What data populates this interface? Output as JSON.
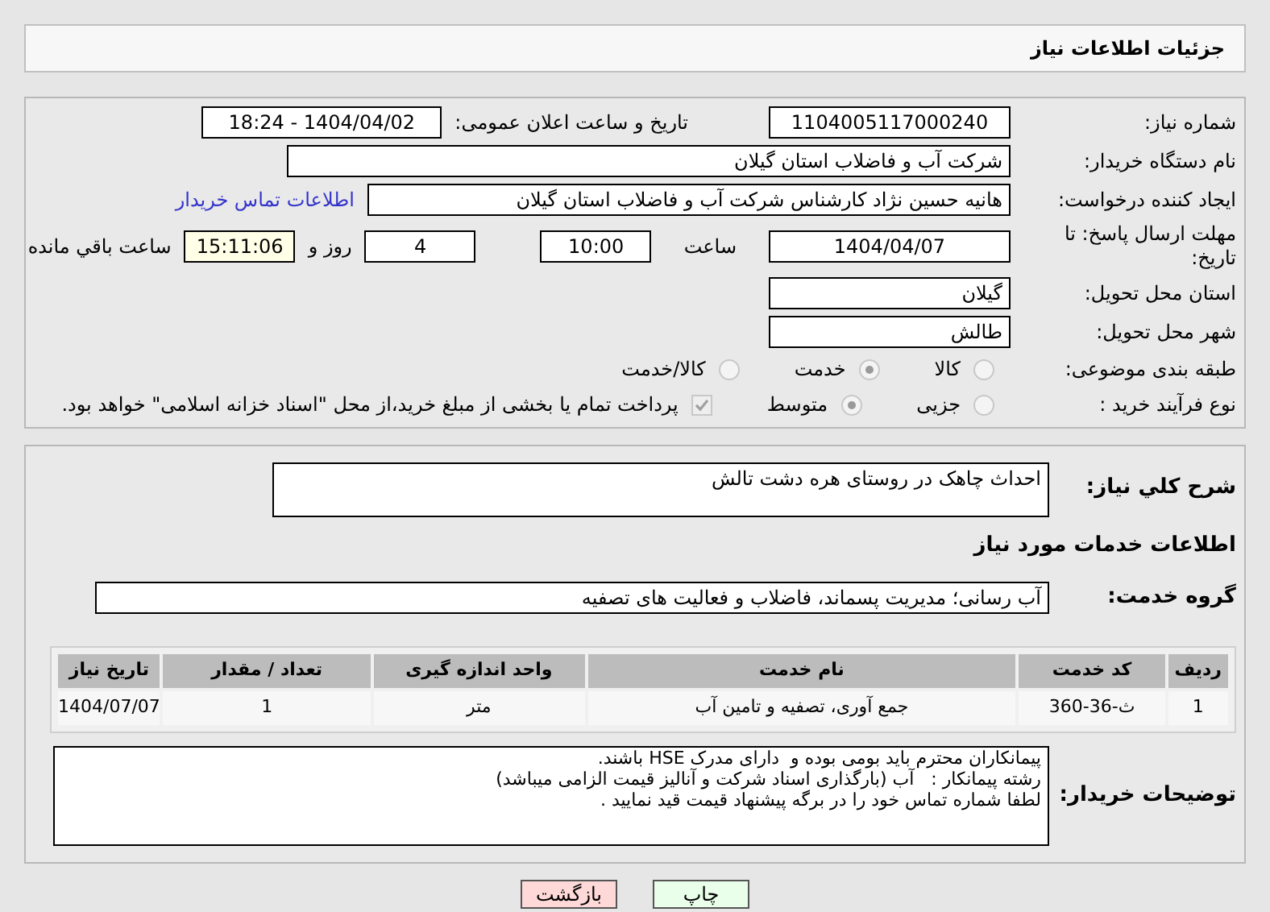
{
  "header": {
    "title": "جزئیات اطلاعات نیاز"
  },
  "need_number": {
    "label": "شماره نیاز:",
    "value": "1104005117000240"
  },
  "announce": {
    "label": "تاریخ و ساعت اعلان عمومی:",
    "value": "1404/04/02 - 18:24"
  },
  "buyer": {
    "label": "نام دستگاه خریدار:",
    "value": "شرکت آب و فاضلاب استان گیلان"
  },
  "creator": {
    "label": "ایجاد کننده درخواست:",
    "value": "هانیه حسین نژاد کارشناس شرکت آب و فاضلاب استان گیلان",
    "link": "اطلاعات تماس خریدار"
  },
  "deadline": {
    "label": "مهلت ارسال پاسخ: تا تاریخ:",
    "date": "1404/04/07",
    "time_label": "ساعت",
    "time": "10:00",
    "days": "4",
    "days_label": "روز و",
    "remaining": "15:11:06",
    "remaining_label": "ساعت باقي مانده"
  },
  "province": {
    "label": "استان محل تحویل:",
    "value": "گیلان"
  },
  "city": {
    "label": "شهر محل تحویل:",
    "value": "طالش"
  },
  "category": {
    "label": "طبقه بندی موضوعی:",
    "options": [
      {
        "label": "کالا",
        "selected": false
      },
      {
        "label": "خدمت",
        "selected": true
      },
      {
        "label": "کالا/خدمت",
        "selected": false
      }
    ]
  },
  "process": {
    "label": "نوع فرآیند خرید :",
    "options": [
      {
        "label": "جزیی",
        "selected": false
      },
      {
        "label": "متوسط",
        "selected": true
      }
    ],
    "payment": {
      "label": "پرداخت تمام یا بخشی از مبلغ خرید،از محل \"اسناد خزانه اسلامی\" خواهد بود.",
      "checked": true
    }
  },
  "summary": {
    "label": "شرح کلي نياز:",
    "value": "احداث چاهک در روستای هره دشت تالش"
  },
  "services_title": "اطلاعات خدمات مورد نیاز",
  "service_group": {
    "label": "گروه خدمت:",
    "value": "آب رسانی؛ مدیریت پسماند، فاضلاب و فعالیت های تصفیه"
  },
  "table": {
    "columns": [
      "ردیف",
      "کد خدمت",
      "نام خدمت",
      "واحد اندازه گیری",
      "تعداد / مقدار",
      "تاریخ نیاز"
    ],
    "rows": [
      [
        "1",
        "ث-36-360",
        "جمع آوری، تصفیه و تامین آب",
        "متر",
        "1",
        "1404/07/07"
      ]
    ]
  },
  "notes": {
    "label": "توضیحات خریدار:",
    "lines": [
      "پیمانکاران محترم باید بومی بوده و  دارای مدرک HSE باشند.",
      "رشته پیمانکار :   آب (بارگذاری اسناد شرکت و آنالیز قیمت الزامی میباشد)",
      "لطفا شماره تماس خود را در برگه پیشنهاد قیمت قید نمایید ."
    ]
  },
  "buttons": [
    {
      "label": "چاپ",
      "kind": "print"
    },
    {
      "label": "بازگشت",
      "kind": "back"
    }
  ]
}
